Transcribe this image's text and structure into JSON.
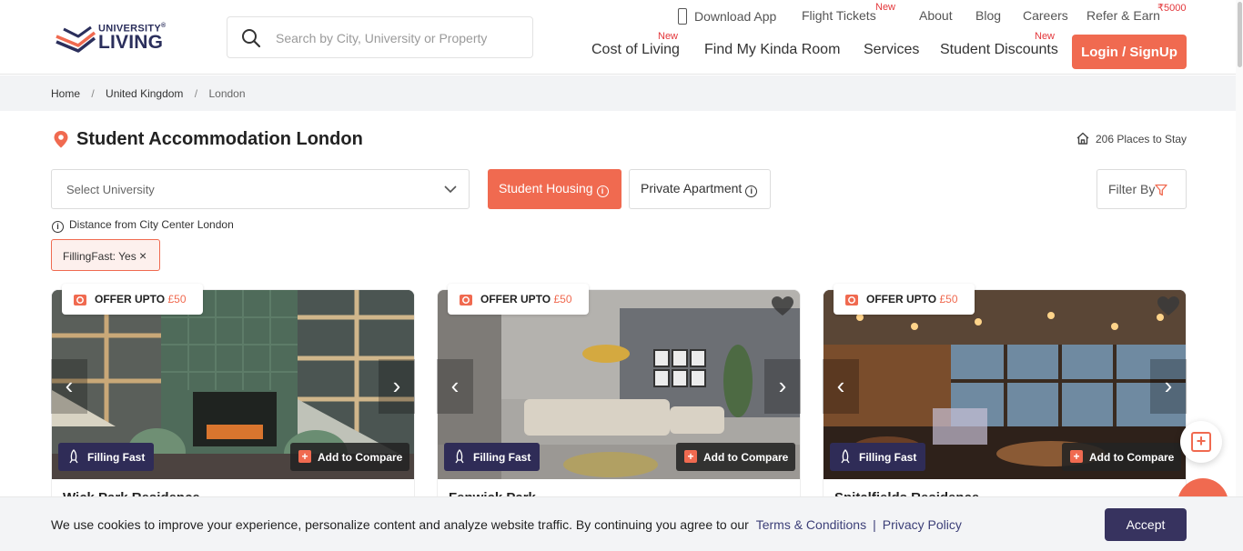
{
  "brand": {
    "logo_top": "UNIVERSITY",
    "logo_registered": "®",
    "logo_bottom": "LIVING"
  },
  "search": {
    "placeholder": "Search by City, University or Property"
  },
  "top_nav": {
    "download_app": "Download App",
    "flight_tickets": "Flight Tickets",
    "flight_tickets_badge": "New",
    "about": "About",
    "blog": "Blog",
    "careers": "Careers",
    "refer_earn": "Refer & Earn",
    "refer_earn_badge": "₹5000"
  },
  "main_nav": {
    "cost_of_living": "Cost of Living",
    "cost_of_living_badge": "New",
    "find_room": "Find My Kinda Room",
    "services": "Services",
    "student_discounts": "Student Discounts",
    "student_discounts_badge": "New"
  },
  "login_label": "Login / SignUp",
  "breadcrumb": {
    "home": "Home",
    "country": "United Kingdom",
    "city": "London"
  },
  "page": {
    "title": "Student Accommodation London",
    "places": "206 Places to Stay"
  },
  "filters": {
    "university_placeholder": "Select University",
    "student_housing": "Student Housing",
    "private_apartment": "Private Apartment",
    "filter_by": "Filter By",
    "distance_note": "Distance from City Center London",
    "active_chip": "FillingFast: Yes"
  },
  "cards": [
    {
      "offer_prefix": "OFFER UPTO",
      "offer_amount": "£50",
      "badge": "Filling Fast",
      "compare": "Add to Compare",
      "title": "Wick Park Residence"
    },
    {
      "offer_prefix": "OFFER UPTO",
      "offer_amount": "£50",
      "badge": "Filling Fast",
      "compare": "Add to Compare",
      "title": "Fenwick Park"
    },
    {
      "offer_prefix": "OFFER UPTO",
      "offer_amount": "£50",
      "badge": "Filling Fast",
      "compare": "Add to Compare",
      "title": "Spitalfields Residence"
    }
  ],
  "cookie": {
    "message": "We use cookies to improve your experience, personalize content and analyze website traffic. By continuing you agree to our",
    "terms": "Terms & Conditions",
    "separator": "|",
    "privacy": "Privacy Policy",
    "accept": "Accept"
  },
  "colors": {
    "accent": "#f06a50",
    "navy": "#2f2c57",
    "new_badge": "#e3363a"
  }
}
